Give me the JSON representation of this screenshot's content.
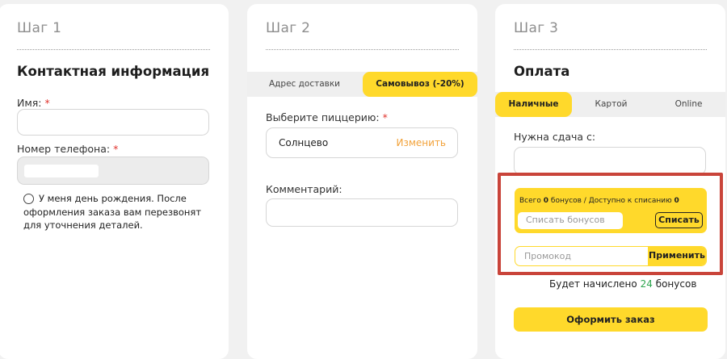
{
  "step1": {
    "title": "Шаг 1",
    "section": "Контактная информация",
    "name_label": "Имя:",
    "phone_label": "Номер телефона:",
    "required_mark": "*",
    "birthday_text": "У меня день рождения. После оформления заказа вам перезвонят для уточнения деталей."
  },
  "step2": {
    "title": "Шаг 2",
    "tabs": [
      "Адрес доставки",
      "Самовывоз (-20%)"
    ],
    "pizzeria_label": "Выберите пиццерию:",
    "pizzeria_value": "Солнцево",
    "change_link": "Изменить",
    "comment_label": "Комментарий:"
  },
  "step3": {
    "title": "Шаг 3",
    "section": "Оплата",
    "pay_tabs": [
      "Наличные",
      "Картой",
      "Online"
    ],
    "change_label": "Нужна сдача с:",
    "bonus": {
      "total_prefix": "Всего",
      "total_value": "0",
      "total_suffix": "бонусов / Доступно к списанию",
      "available_value": "0",
      "input_placeholder": "Списать бонусов",
      "button": "Списать"
    },
    "promo": {
      "placeholder": "Промокод",
      "button": "Применить"
    },
    "accrual": {
      "prefix": "Будет начислено",
      "value": "24",
      "suffix": "бонусов"
    },
    "order_button": "Оформить заказ"
  },
  "colors": {
    "accent": "#ffd92b",
    "highlight_frame": "#c9443a",
    "link": "#f2a23a",
    "required": "#e0332d",
    "bonus_green": "#2ea44f"
  }
}
